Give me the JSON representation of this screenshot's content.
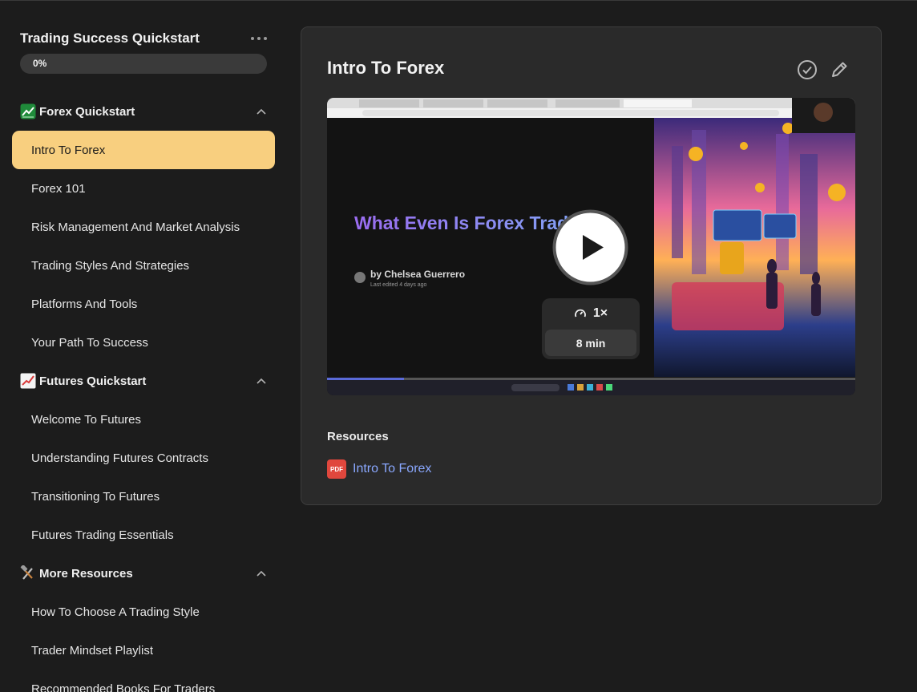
{
  "course": {
    "title": "Trading Success Quickstart",
    "progress": "0%"
  },
  "sections": [
    {
      "emoji": "chart-increasing-green-emoji",
      "title": "Forex Quickstart",
      "lessons": [
        "Intro To Forex",
        "Forex 101",
        "Risk Management And Market Analysis",
        "Trading Styles And Strategies",
        "Platforms And Tools",
        "Your Path To Success"
      ]
    },
    {
      "emoji": "chart-increasing-emoji",
      "title": "Futures Quickstart",
      "lessons": [
        "Welcome To Futures",
        "Understanding Futures Contracts",
        "Transitioning To Futures",
        "Futures Trading Essentials"
      ]
    },
    {
      "emoji": "hammer-and-wrench-emoji",
      "title": "More Resources",
      "lessons": [
        "How To Choose A Trading Style",
        "Trader Mindset Playlist",
        "Recommended Books For Traders"
      ]
    }
  ],
  "active_lesson": "Intro To Forex",
  "main": {
    "title": "Intro To Forex",
    "video": {
      "slide_title": "What Even Is Forex Trading?",
      "author": "by Chelsea Guerrero",
      "edited": "Last edited 4 days ago",
      "speed": "1×",
      "duration": "8 min",
      "accent": "#8b6cf0"
    },
    "resources_heading": "Resources",
    "resources": [
      {
        "type": "PDF",
        "label": "Intro To Forex"
      }
    ]
  },
  "colors": {
    "active_bg": "#f8cf7f",
    "link": "#8aa8ff",
    "pdf": "#e0473d",
    "panel": "#2a2a2a",
    "page": "#1c1c1c"
  }
}
